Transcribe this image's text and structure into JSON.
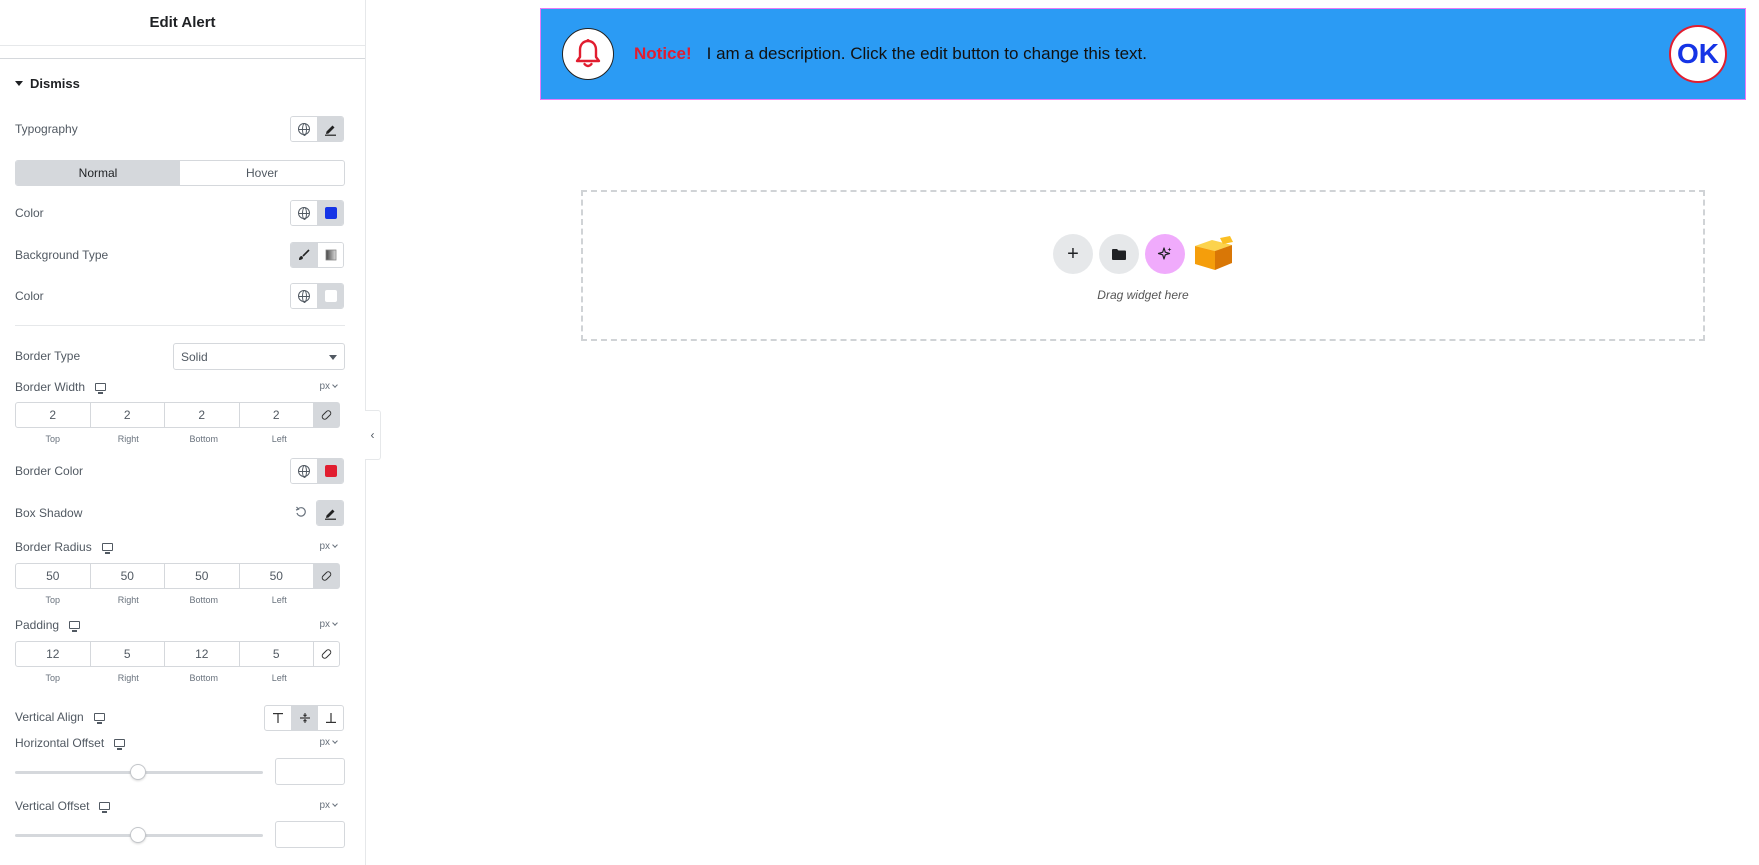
{
  "panel": {
    "title": "Edit Alert",
    "section": "Dismiss",
    "typography": {
      "label": "Typography"
    },
    "tabs": [
      {
        "label": "Normal",
        "active": true
      },
      {
        "label": "Hover",
        "active": false
      }
    ],
    "color": {
      "label": "Color",
      "value": "#1534e6"
    },
    "background_type": {
      "label": "Background Type"
    },
    "bg_color": {
      "label": "Color",
      "value": "#ffffff"
    },
    "border_type": {
      "label": "Border Type",
      "value": "Solid"
    },
    "border_width": {
      "label": "Border Width",
      "unit": "px",
      "top": "2",
      "right": "2",
      "bottom": "2",
      "left": "2"
    },
    "dim_labels": {
      "top": "Top",
      "right": "Right",
      "bottom": "Bottom",
      "left": "Left"
    },
    "border_color": {
      "label": "Border Color",
      "value": "#e11d2f"
    },
    "box_shadow": {
      "label": "Box Shadow"
    },
    "border_radius": {
      "label": "Border Radius",
      "unit": "px",
      "top": "50",
      "right": "50",
      "bottom": "50",
      "left": "50"
    },
    "padding": {
      "label": "Padding",
      "unit": "px",
      "top": "12",
      "right": "5",
      "bottom": "12",
      "left": "5"
    },
    "vertical_align": {
      "label": "Vertical Align",
      "selected": "middle"
    },
    "horizontal_offset": {
      "label": "Horizontal Offset",
      "unit": "px",
      "value": ""
    },
    "vertical_offset": {
      "label": "Vertical Offset",
      "unit": "px",
      "value": ""
    }
  },
  "alert": {
    "notice": "Notice!",
    "description": "I am a description. Click the edit button to change this text.",
    "dismiss_label": "OK",
    "background": "#2b9bf4"
  },
  "dropzone": {
    "text": "Drag widget here",
    "icons": [
      "plus-icon",
      "folder-icon",
      "ai-sparkle-icon",
      "cube-icon"
    ]
  }
}
